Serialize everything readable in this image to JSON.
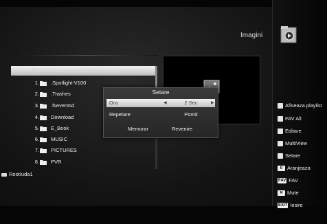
{
  "header": {
    "title": "Imagini"
  },
  "file_browser": {
    "up_entry": "..",
    "items": [
      {
        "num": "1.",
        "name": ".Spotlight-V100"
      },
      {
        "num": "2.",
        "name": ".Trashes"
      },
      {
        "num": "3.",
        "name": ".fseventsd"
      },
      {
        "num": "4.",
        "name": "Download"
      },
      {
        "num": "5.",
        "name": "E_Book"
      },
      {
        "num": "6.",
        "name": "MUSIC"
      },
      {
        "num": "7.",
        "name": "PICTURES"
      },
      {
        "num": "8.",
        "name": "PVR"
      }
    ],
    "path": "Root/uda1"
  },
  "dialog": {
    "title": "Setare",
    "rows": [
      {
        "label": "Ora",
        "value": "2 Sec"
      },
      {
        "label": "Repetare",
        "value": "Pornit"
      }
    ],
    "save_label": "Memorar",
    "back_label": "Revenire"
  },
  "legend": {
    "items": [
      {
        "key": "red",
        "label": "Afiseaza playlist"
      },
      {
        "key": "green",
        "label": "FAV All"
      },
      {
        "key": "yellow",
        "label": "Editare"
      },
      {
        "key": "blue",
        "label": "MultiView"
      },
      {
        "key": "white",
        "label": "Setare"
      },
      {
        "key": "0",
        "label": "Aranjeaza"
      },
      {
        "key": "FAV",
        "label": "FAV"
      },
      {
        "key": "mute",
        "label": "Mute"
      },
      {
        "key": "EXIT",
        "label": "Iesire"
      }
    ]
  },
  "colors": {
    "red": "#e6e6e6",
    "green": "#e6e6e6",
    "yellow": "#e6e6e6",
    "blue": "#e6e6e6",
    "white": "#e6e6e6"
  }
}
